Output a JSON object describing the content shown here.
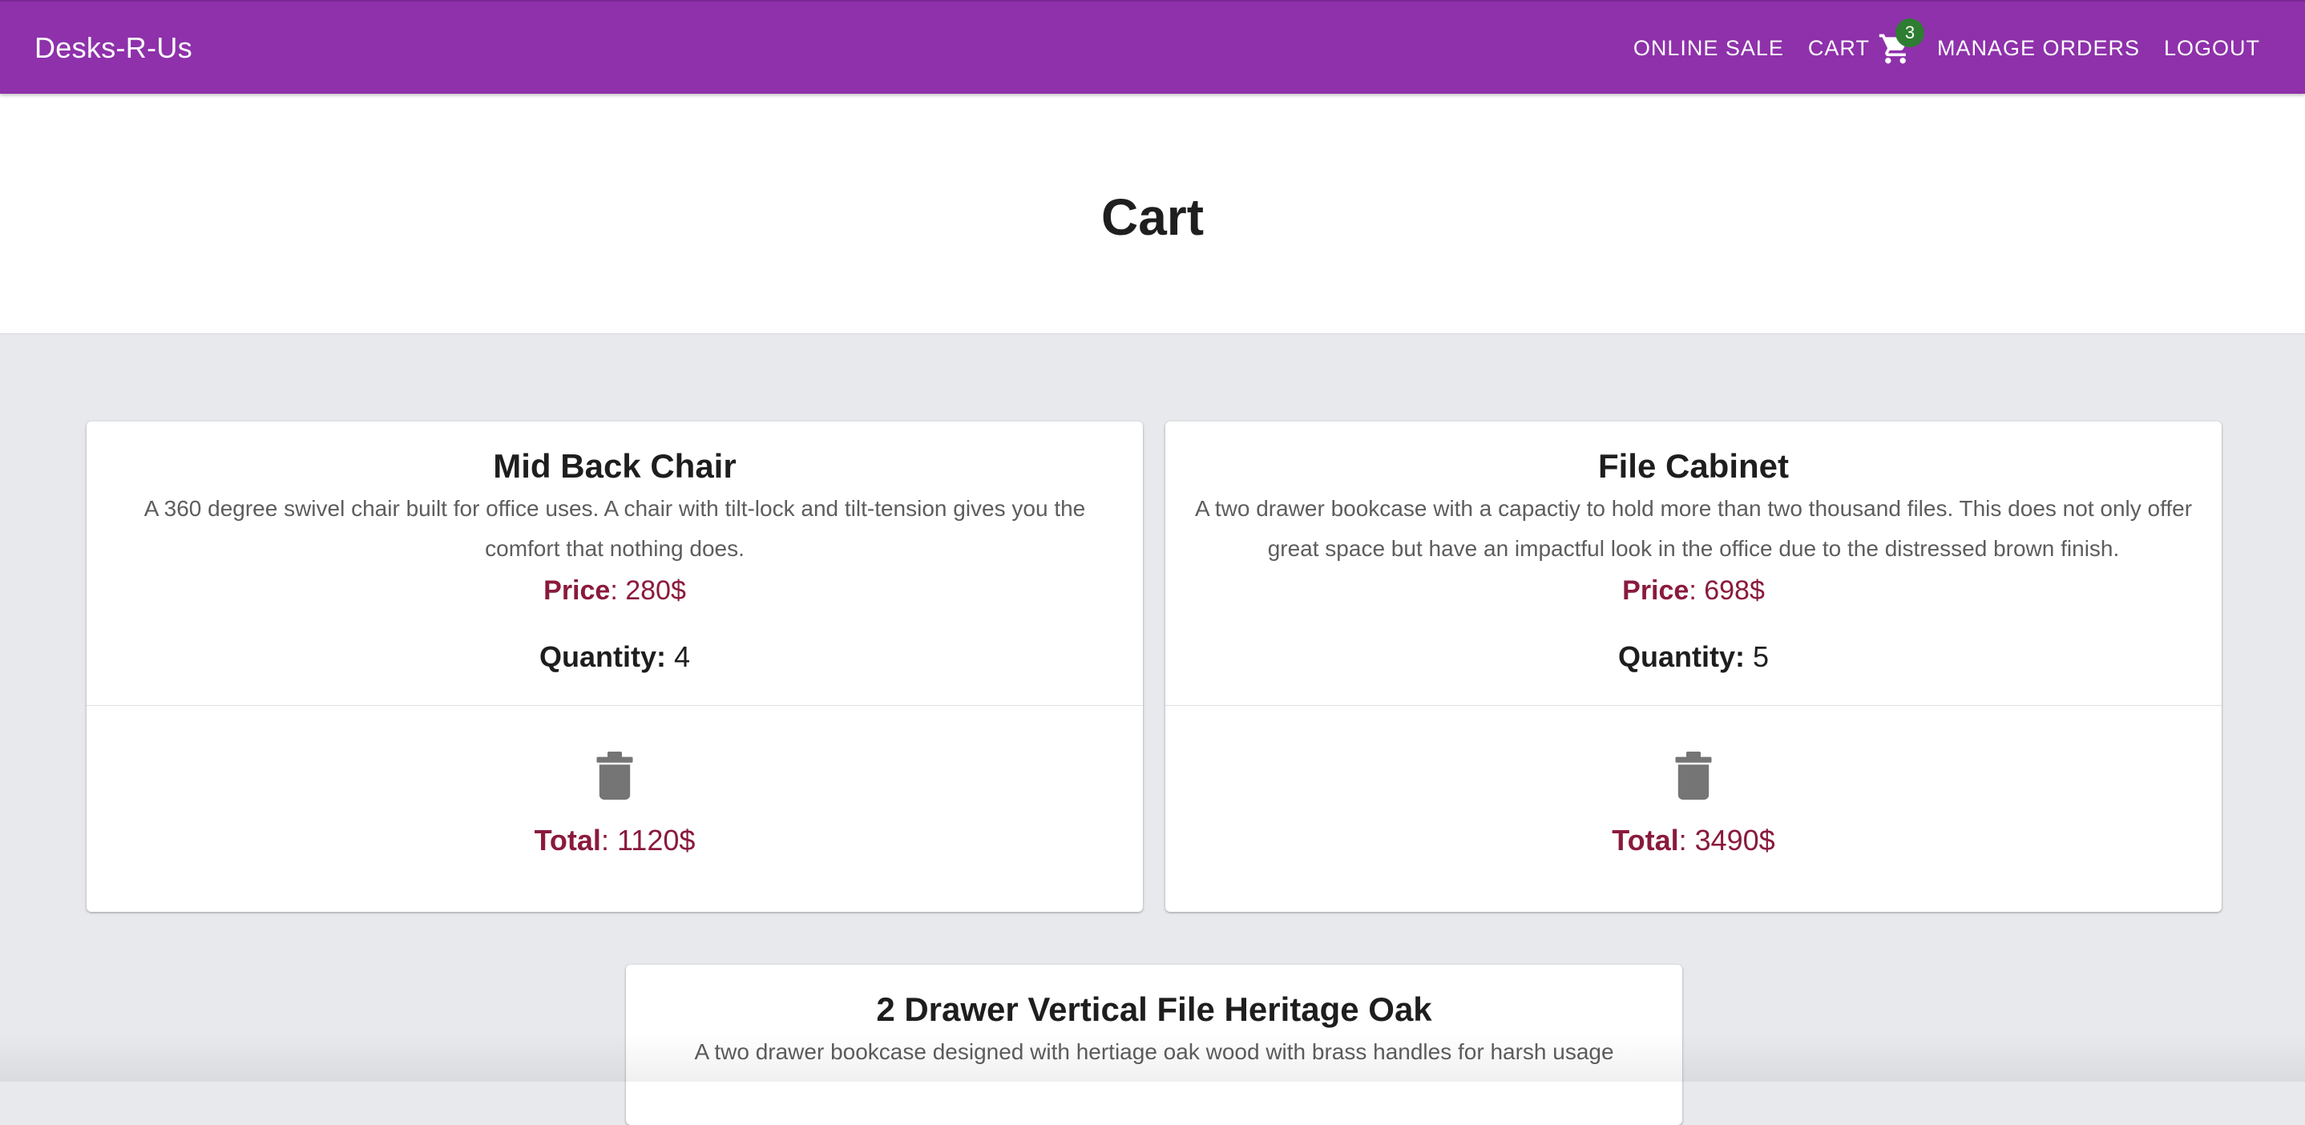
{
  "app": {
    "brand": "Desks-R-Us"
  },
  "nav": {
    "online_sale": "ONLINE SALE",
    "cart": "CART",
    "cart_count": "3",
    "manage_orders": "MANAGE ORDERS",
    "logout": "LOGOUT"
  },
  "page": {
    "title": "Cart"
  },
  "labels": {
    "price": "Price",
    "quantity": "Quantity:",
    "total": "Total"
  },
  "items": [
    {
      "name": "Mid Back Chair",
      "description": "A 360 degree swivel chair built for office uses. A chair with tilt-lock and tilt-tension gives you the comfort that nothing does.",
      "price": ": 280$",
      "quantity": "4",
      "total": ": 1120$"
    },
    {
      "name": "File Cabinet",
      "description": "A two drawer bookcase with a capactiy to hold more than two thousand files. This does not only offer great space but have an impactful look in the office due to the distressed brown finish.",
      "price": ": 698$",
      "quantity": "5",
      "total": ": 3490$"
    },
    {
      "name": "2 Drawer Vertical File Heritage Oak",
      "description": "A two drawer bookcase designed with hertiage oak wood with brass handles for harsh usage"
    }
  ],
  "colors": {
    "appbar": "#8e31ab",
    "badge": "#2e7d32",
    "accent_price": "#8a1a3c",
    "background": "#e7e9ed"
  },
  "icons": {
    "cart": "shopping-cart-icon",
    "delete": "trash-icon"
  }
}
